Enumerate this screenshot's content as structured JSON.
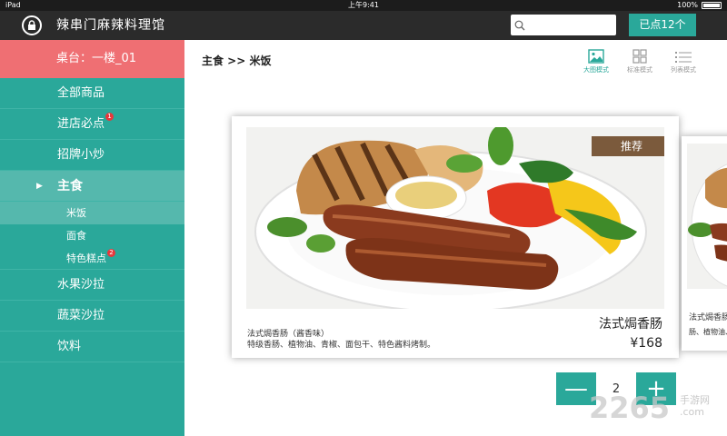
{
  "status_bar": {
    "device": "iPad",
    "time": "上午9:41",
    "battery": "100%"
  },
  "header": {
    "title": "辣串门麻辣料理馆",
    "search_placeholder": "",
    "ordered_button": "已点12个"
  },
  "sidebar": {
    "table": "桌台：一楼_01",
    "items": [
      {
        "label": "全部商品"
      },
      {
        "label": "进店必点",
        "badge": "1"
      },
      {
        "label": "招牌小炒"
      },
      {
        "label": "主食",
        "active": true
      },
      {
        "label": "米饭",
        "sub": true,
        "active": true
      },
      {
        "label": "面食",
        "sub": true
      },
      {
        "label": "特色糕点",
        "sub": true,
        "badge": "2"
      },
      {
        "label": "水果沙拉"
      },
      {
        "label": "蔬菜沙拉"
      },
      {
        "label": "饮料"
      }
    ]
  },
  "main": {
    "breadcrumb": "主食 >> 米饭",
    "view_modes": [
      {
        "label": "大图模式",
        "icon": "image-icon",
        "active": true
      },
      {
        "label": "标准模式",
        "icon": "grid-icon"
      },
      {
        "label": "列表模式",
        "icon": "list-icon"
      }
    ],
    "card": {
      "tag": "推荐",
      "title": "法式焗香肠",
      "subtitle_line1": "法式焗香肠（酱香味）",
      "subtitle_line2": "特级香肠、植物油、青椒、面包干、特色酱料烤制。",
      "price": "¥168"
    },
    "card_peek": {
      "title": "法式焗香肠（酱",
      "subtitle": "肠、植物油、青"
    },
    "quantity": {
      "minus": "—",
      "value": "2",
      "plus": "+"
    }
  },
  "watermark": {
    "main": "2265",
    "sub_line1": "手游网",
    "sub_line2": ".com"
  },
  "colors": {
    "teal": "#2aa89a",
    "coral": "#ef6f73",
    "header": "#2b2b2b",
    "tag": "#7b5a3c"
  }
}
